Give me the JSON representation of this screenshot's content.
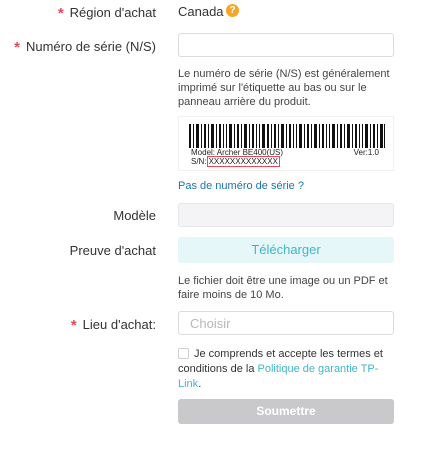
{
  "region": {
    "label": "Région d'achat",
    "value": "Canada",
    "help_icon": "?"
  },
  "serial": {
    "label": "Numéro de série (N/S)",
    "value": "",
    "placeholder": "",
    "note": "Le numéro de série (N/S) est généralement imprimé sur l'étiquette au bas ou sur le panneau arrière du produit.",
    "barcode": {
      "model_text": "Model: Archer BE400(US)",
      "version_text": "Ver:1.0",
      "sn_prefix": "S/N:",
      "sn_value": "XXXXXXXXXXXXX"
    },
    "no_serial_link": "Pas de numéro de série ?"
  },
  "model": {
    "label": "Modèle",
    "value": ""
  },
  "proof": {
    "label": "Preuve d'achat",
    "upload_label": "Télécharger",
    "note": "Le fichier doit être une image ou un PDF et faire moins de 10 Mo."
  },
  "place": {
    "label": "Lieu d'achat:",
    "placeholder": "Choisir"
  },
  "agreement": {
    "checked": false,
    "text_before": "Je comprends et accepte les termes et conditions de la ",
    "link_text": "Politique de garantie TP-Link",
    "text_after": "."
  },
  "submit_label": "Soumettre",
  "required_mark": "*",
  "colors": {
    "required": "#e8475a",
    "accent": "#3fb6c8",
    "link": "#1a75b0",
    "help": "#f5a623",
    "submit_disabled": "#c9c9cb"
  }
}
